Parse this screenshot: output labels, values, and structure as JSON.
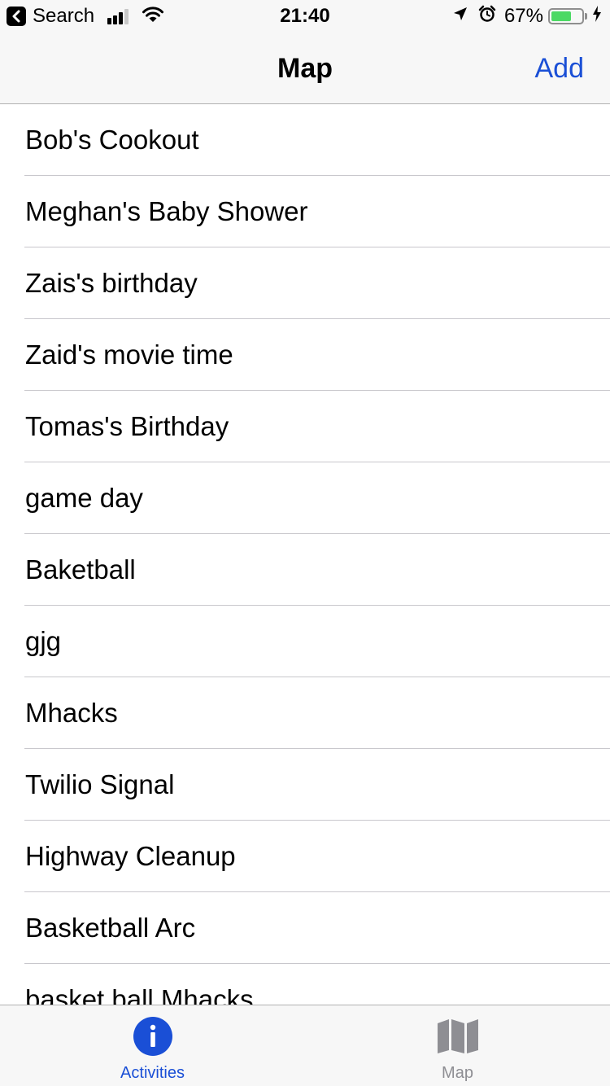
{
  "status_bar": {
    "back_label": "Search",
    "time": "21:40",
    "battery_percent": "67%",
    "battery_level": 0.67,
    "signal_bars_filled": 3,
    "signal_bars_total": 4
  },
  "nav": {
    "title": "Map",
    "add_label": "Add"
  },
  "list": {
    "items": [
      {
        "label": "Bob's Cookout"
      },
      {
        "label": "Meghan's Baby Shower"
      },
      {
        "label": "Zais's birthday"
      },
      {
        "label": "Zaid's movie time"
      },
      {
        "label": "Tomas's Birthday"
      },
      {
        "label": "game day"
      },
      {
        "label": "Baketball"
      },
      {
        "label": "gjg"
      },
      {
        "label": "Mhacks"
      },
      {
        "label": "Twilio Signal"
      },
      {
        "label": "Highway Cleanup"
      },
      {
        "label": "Basketball Arc"
      },
      {
        "label": "basket ball Mhacks"
      }
    ]
  },
  "tab_bar": {
    "tabs": [
      {
        "label": "Activities",
        "icon": "info-icon",
        "active": true
      },
      {
        "label": "Map",
        "icon": "map-icon",
        "active": false
      }
    ]
  },
  "colors": {
    "accent": "#1a4fd6",
    "inactive": "#8e8e93",
    "battery_fill": "#4cd964",
    "bar_background": "#f7f7f7"
  }
}
